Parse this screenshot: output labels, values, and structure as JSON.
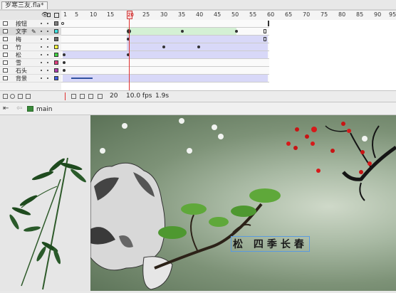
{
  "window": {
    "doc_tab": "岁寒三友.fla*"
  },
  "timeline": {
    "ruler_ticks": [
      "1",
      "5",
      "10",
      "15",
      "20",
      "25",
      "30",
      "35",
      "40",
      "45",
      "50",
      "55",
      "60",
      "65",
      "70",
      "75",
      "80",
      "85",
      "90",
      "95"
    ],
    "playhead_frame": "20",
    "layers": [
      {
        "name": "按钮",
        "color": "#808080",
        "selected": false
      },
      {
        "name": "文字",
        "color": "#40e0e0",
        "selected": true
      },
      {
        "name": "梅",
        "color": "#6b6b6b",
        "selected": false
      },
      {
        "name": "竹",
        "color": "#ffff40",
        "selected": false
      },
      {
        "name": "松",
        "color": "#40d040",
        "selected": false
      },
      {
        "name": "雪",
        "color": "#e04080",
        "selected": false
      },
      {
        "name": "石头",
        "color": "#b040b0",
        "selected": false
      },
      {
        "name": "背景",
        "color": "#4060e0",
        "selected": false
      }
    ],
    "footer": {
      "current_frame": "20",
      "fps": "10.0 fps",
      "elapsed": "1.9s"
    }
  },
  "edit_bar": {
    "scene": "main"
  },
  "stage": {
    "caption": "松  四季长春"
  },
  "colors": {
    "playhead": "#e03030",
    "selection": "#5a9adf",
    "tween_motion": "#d8d8f8",
    "tween_shape": "#d4f0d4"
  }
}
